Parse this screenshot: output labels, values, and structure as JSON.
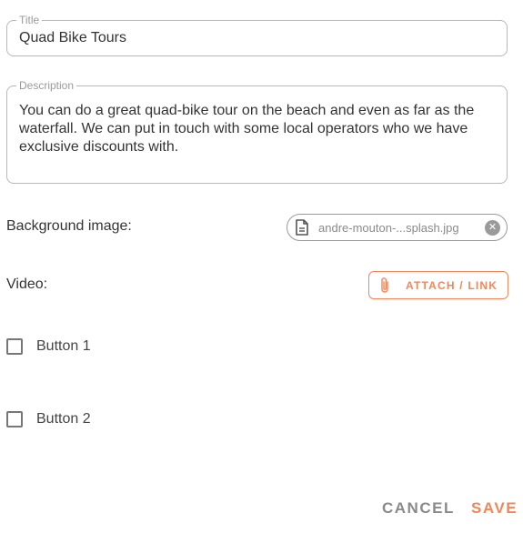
{
  "title_field": {
    "legend": "Title",
    "value": "Quad Bike Tours"
  },
  "description_field": {
    "legend": "Description",
    "value": "You can do a great quad-bike tour on the beach and even as far as the waterfall.  We can put in touch with some local operators who we have exclusive discounts with."
  },
  "background_image": {
    "label": "Background image:",
    "file_name": "andre-mouton-...splash.jpg",
    "file_icon": "document-icon",
    "remove_icon": "close-circle-icon"
  },
  "video": {
    "label": "Video:",
    "attach_label": "ATTACH / LINK",
    "attach_icon": "paperclip-icon"
  },
  "buttons": [
    {
      "label": "Button 1",
      "checked": false
    },
    {
      "label": "Button 2",
      "checked": false
    }
  ],
  "footer": {
    "cancel_label": "CANCEL",
    "save_label": "SAVE"
  },
  "colors": {
    "accent": "#f0875a",
    "muted": "#8a8a8a",
    "border": "#b8b8b8"
  }
}
